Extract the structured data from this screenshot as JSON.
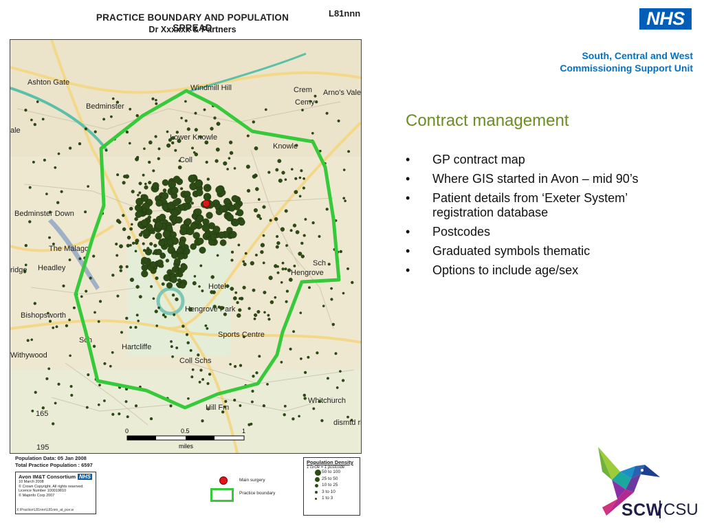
{
  "map": {
    "title": "PRACTICE BOUNDARY AND POPULATION SPREAD",
    "subtitle": "Dr Xxxxxx & Partners",
    "code": "L81nnn",
    "places": [
      "Windmill Hill",
      "Ashton Gate",
      "Bedminster",
      "Lower Knowle",
      "Knowle",
      "Crem",
      "Cemy",
      "Arno's Vale",
      "Bedminster Down",
      "Headley",
      "Hengrove",
      "Sch",
      "Hotel",
      "Hengrove Park",
      "Sports Centre",
      "Bishopsworth",
      "Hartcliffe",
      "Withywood",
      "Coll Schs",
      "Whitchurch",
      "Hill Fm",
      "Coll",
      "The Malago",
      "dismtd rly",
      "165",
      "195",
      "ridge",
      "ale",
      "Sch"
    ],
    "scale": {
      "zero": "0",
      "half": "0.5",
      "one": "1",
      "unit": "miles"
    },
    "population_date": "Population Data: 05 Jan 2008",
    "total_population": "Total Practice Population : 6597",
    "consortium": {
      "name": "Avon IM&T Consortium",
      "nhs": "NHS",
      "lines": [
        "10 March 2008",
        "© Crown Copyright. All rights reserved.",
        "Licence Number 100019810",
        "© Mapinfo Corp 2007"
      ],
      "path": "X:\\Practice\\L81nnn\\L81nnn_at_pce.w"
    },
    "legend": {
      "surgery": "Main surgery",
      "boundary": "Practice boundary"
    },
    "density": {
      "title": "Population Density",
      "subtitle": "1 circle = 1 postcode",
      "rows": [
        {
          "label": "50 to 100",
          "size": 9
        },
        {
          "label": "25 to  50",
          "size": 7
        },
        {
          "label": "10 to  25",
          "size": 5
        },
        {
          "label": " 3 to  10",
          "size": 4
        },
        {
          "label": " 1 to   3",
          "size": 3
        }
      ]
    }
  },
  "brand": {
    "nhs": "NHS",
    "org_line1": "South, Central and West",
    "org_line2": "Commissioning Support Unit",
    "scw": "SCW",
    "csu": "CSU"
  },
  "slide": {
    "heading": "Contract management",
    "bullet_char": "•",
    "bullets": [
      "GP contract map",
      "Where GIS started in Avon – mid 90’s",
      "Patient details from ‘Exeter System’ registration database",
      "Postcodes",
      "Graduated symbols thematic",
      "Options to include age/sex"
    ]
  },
  "colors": {
    "heading": "#6b8e23",
    "brand_blue": "#0072c6",
    "nhs_blue": "#005eb8",
    "boundary": "#36c93a",
    "dots": "#2d4b15",
    "surgery": "#e0161a"
  }
}
